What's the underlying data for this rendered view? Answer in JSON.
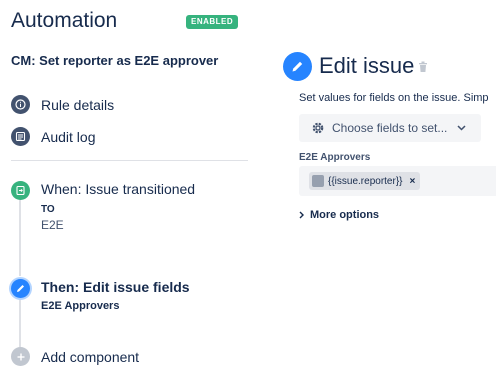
{
  "header": {
    "title": "Automation",
    "status_badge": "ENABLED"
  },
  "rule": {
    "name": "CM: Set reporter as E2E approver"
  },
  "nav": [
    {
      "label": "Rule details",
      "icon": "info-icon"
    },
    {
      "label": "Audit log",
      "icon": "list-icon"
    }
  ],
  "steps": {
    "trigger": {
      "label": "When: Issue transitioned",
      "sub_label": "TO",
      "sub_value": "E2E",
      "icon": "transition-icon"
    },
    "action": {
      "label": "Then: Edit issue fields",
      "sub_value": "E2E Approvers",
      "icon": "pencil-icon"
    },
    "add": {
      "label": "Add component",
      "icon": "plus-icon"
    }
  },
  "panel": {
    "title": "Edit issue",
    "description": "Set values for fields on the issue. Simp",
    "choose_fields": "Choose fields to set...",
    "field_label": "E2E Approvers",
    "field_chip": "{{issue.reporter}}",
    "more_options": "More options"
  },
  "colors": {
    "accent": "#2684ff",
    "enabled": "#36b37e",
    "trigger": "#36b37e",
    "neutral": "#42526e"
  }
}
